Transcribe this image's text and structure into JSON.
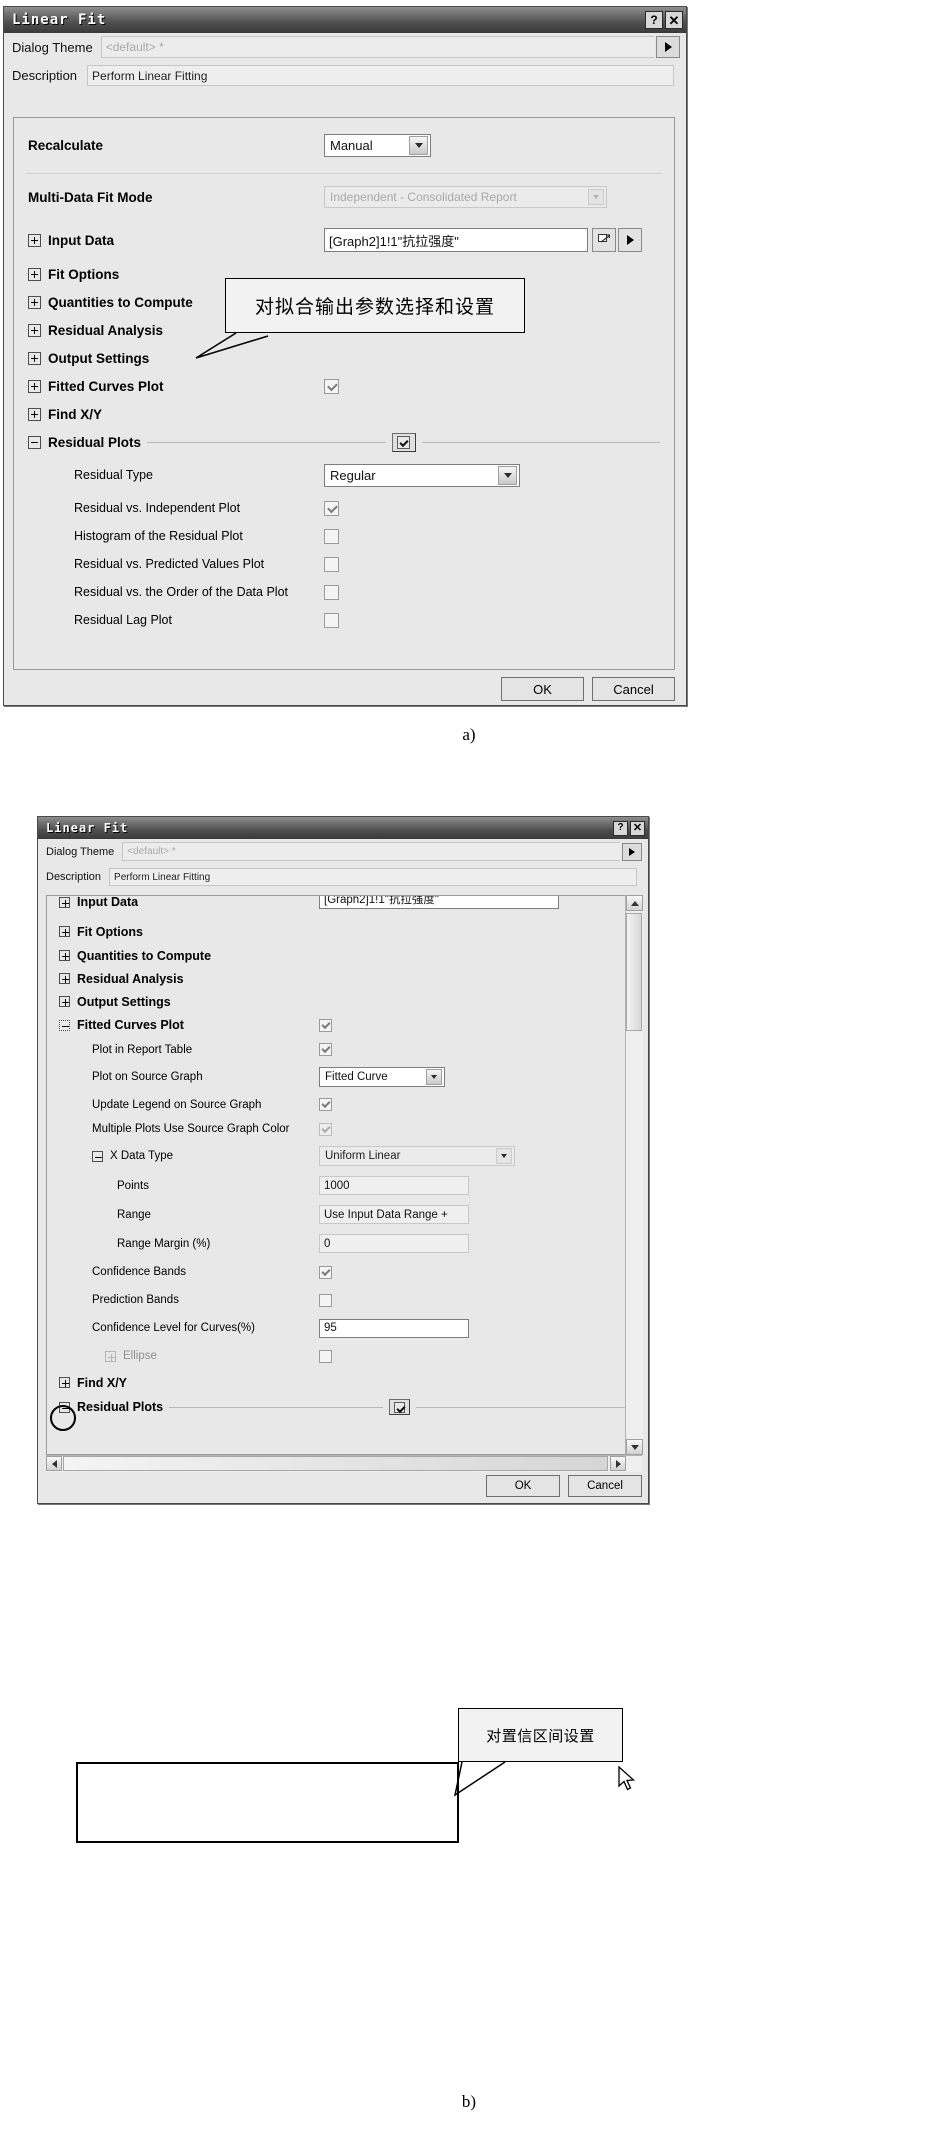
{
  "figure": {
    "caption_a": "a)",
    "caption_b": "b)"
  },
  "dialog_a": {
    "title": "Linear Fit",
    "titlebar_buttons": {
      "help": "?",
      "close": "✕"
    },
    "theme_label": "Dialog Theme",
    "theme_value": "<default> *",
    "description_label": "Description",
    "description_value": "Perform Linear Fitting",
    "expand_arrow": "▶",
    "rows": {
      "recalculate": {
        "label": "Recalculate",
        "value": "Manual"
      },
      "multi_data_fit_mode": {
        "label": "Multi-Data Fit Mode",
        "value": "Independent - Consolidated Report"
      },
      "input_data": {
        "label": "Input Data",
        "value": "[Graph2]1!1\"抗拉强度\""
      },
      "fit_options": {
        "label": "Fit Options"
      },
      "quantities_to_compute": {
        "label": "Quantities to Compute"
      },
      "residual_analysis": {
        "label": "Residual Analysis"
      },
      "output_settings": {
        "label": "Output Settings"
      },
      "fitted_curves_plot": {
        "label": "Fitted Curves Plot",
        "checked": true
      },
      "find_xy": {
        "label": "Find X/Y"
      },
      "residual_plots": {
        "label": "Residual Plots",
        "checked": true
      },
      "residual_type": {
        "label": "Residual Type",
        "value": "Regular"
      },
      "residual_vs_independent": {
        "label": "Residual vs. Independent Plot",
        "checked": true
      },
      "histogram_residual": {
        "label": "Histogram of the Residual Plot",
        "checked": false
      },
      "residual_vs_predicted": {
        "label": "Residual vs. Predicted Values Plot",
        "checked": false
      },
      "residual_vs_order": {
        "label": "Residual vs. the Order of the Data Plot",
        "checked": false
      },
      "residual_lag": {
        "label": "Residual Lag Plot",
        "checked": false
      }
    },
    "buttons": {
      "ok": "OK",
      "cancel": "Cancel"
    },
    "callout": "对拟合输出参数选择和设置"
  },
  "dialog_b": {
    "title": "Linear Fit",
    "titlebar_buttons": {
      "help": "?",
      "close": "✕"
    },
    "theme_label": "Dialog Theme",
    "theme_value": "<default> *",
    "description_label": "Description",
    "description_value": "Perform Linear Fitting",
    "expand_arrow": "▶",
    "rows": {
      "input_data": {
        "label": "Input Data",
        "value": "[Graph2]1!1\"抗拉强度\""
      },
      "fit_options": {
        "label": "Fit Options"
      },
      "quantities_to_compute": {
        "label": "Quantities to Compute"
      },
      "residual_analysis": {
        "label": "Residual Analysis"
      },
      "output_settings": {
        "label": "Output Settings"
      },
      "fitted_curves_plot": {
        "label": "Fitted Curves Plot",
        "checked": true
      },
      "plot_in_report_table": {
        "label": "Plot in Report Table",
        "checked": true
      },
      "plot_on_source_graph": {
        "label": "Plot on Source Graph",
        "value": "Fitted Curve"
      },
      "update_legend": {
        "label": "Update Legend on Source Graph",
        "checked": true
      },
      "multiple_plots_color": {
        "label": "Multiple Plots Use Source Graph Color",
        "checked": true
      },
      "x_data_type": {
        "label": "X Data Type",
        "value": "Uniform Linear"
      },
      "points": {
        "label": "Points",
        "value": "1000"
      },
      "range": {
        "label": "Range",
        "value": "Use Input Data Range +"
      },
      "range_margin": {
        "label": "Range Margin (%)",
        "value": "0"
      },
      "confidence_bands": {
        "label": "Confidence Bands",
        "checked": true
      },
      "prediction_bands": {
        "label": "Prediction Bands",
        "checked": false
      },
      "confidence_level": {
        "label": "Confidence Level for Curves(%)",
        "value": "95"
      },
      "ellipse": {
        "label": "Ellipse",
        "checked": false
      },
      "find_xy": {
        "label": "Find X/Y"
      },
      "residual_plots": {
        "label": "Residual Plots",
        "checked": true
      }
    },
    "buttons": {
      "ok": "OK",
      "cancel": "Cancel"
    },
    "callout": "对置信区间设置"
  }
}
